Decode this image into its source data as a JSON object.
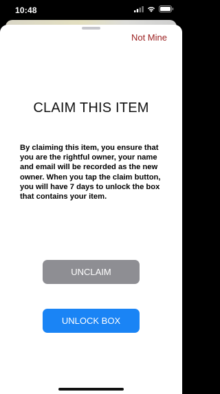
{
  "status_bar": {
    "time": "10:48",
    "icons": [
      "signal-icon",
      "wifi-icon",
      "battery-icon"
    ]
  },
  "header": {
    "not_mine_label": "Not Mine"
  },
  "main": {
    "title": "CLAIM THIS ITEM",
    "description": "By claiming this item, you ensure that you are the rightful owner, your name and email will be recorded as the new owner. When you tap the claim button, you will have 7 days to unlock the box that contains your item."
  },
  "actions": {
    "unclaim_label": "UNCLAIM",
    "unlock_label": "UNLOCK BOX"
  },
  "colors": {
    "accent": "#1a84f5",
    "disabled": "#8e8e93",
    "destructive_text": "#9a1d1d"
  }
}
